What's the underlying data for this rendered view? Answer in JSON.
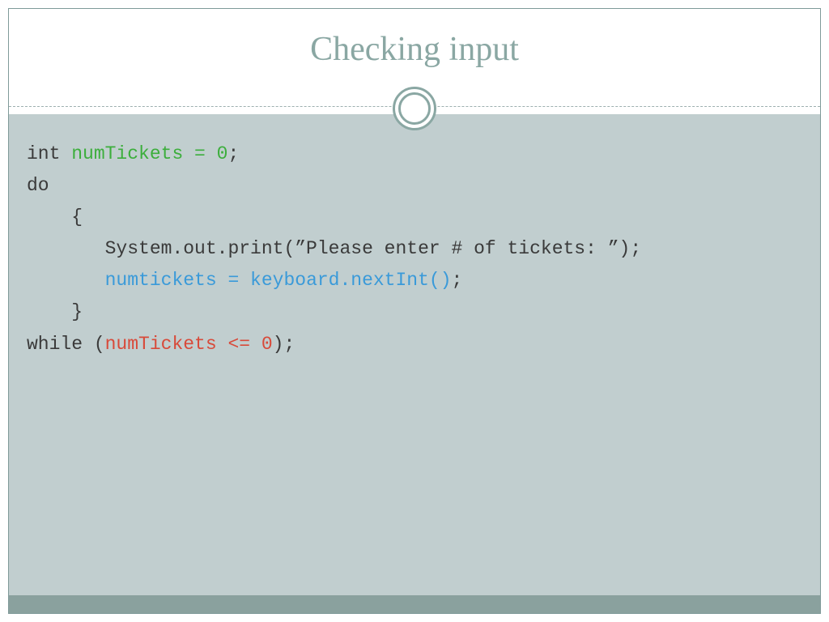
{
  "title": "Checking input",
  "code": {
    "line1": {
      "kw": "int ",
      "green": "numTickets = 0",
      "tail": ";"
    },
    "line2": "do",
    "line3": "    {",
    "line4": "       System.out.print(”Please enter # of tickets: ”);",
    "line5": {
      "lead": "       ",
      "blue": "numtickets = keyboard.nextInt()",
      "tail": ";"
    },
    "line6": "    }",
    "line7": {
      "lead": "while (",
      "red": "numTickets <= 0",
      "tail": ");"
    }
  }
}
